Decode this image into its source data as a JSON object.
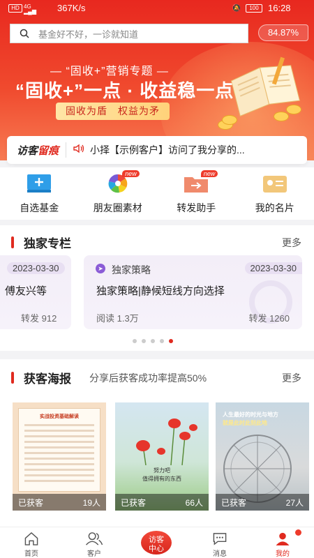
{
  "status_bar": {
    "network": "4G",
    "hd": "HD",
    "speed": "367K/s",
    "battery": "100",
    "time": "16:28"
  },
  "search": {
    "placeholder": "基金好不好，一诊就知道",
    "percent": "84.87%"
  },
  "banner": {
    "subtitle": "— “固收+”营销专题 —",
    "title": "“固收+”一点 · 收益稳一点",
    "slogan": "固收为盾　权益为矛"
  },
  "visitor_trace": {
    "tag_part1": "访客",
    "tag_part2": "留痕",
    "message": "小择【示例客户】访问了我分享的..."
  },
  "tools": [
    {
      "label": "自选基金",
      "icon": "add-fund-icon",
      "new": false
    },
    {
      "label": "朋友圈素材",
      "icon": "moments-material-icon",
      "new": true,
      "badge": "new"
    },
    {
      "label": "转发助手",
      "icon": "forward-assistant-icon",
      "new": true,
      "badge": "new"
    },
    {
      "label": "我的名片",
      "icon": "business-card-icon",
      "new": false
    }
  ],
  "exclusive": {
    "title": "独家专栏",
    "more": "更多",
    "cards": [
      {
        "date": "2023-03-30",
        "headline": "、傅友兴等",
        "read": "",
        "share": "转发 912"
      },
      {
        "category": "独家策略",
        "date": "2023-03-30",
        "headline": "独家策略|静候短线方向选择",
        "read": "阅读 1.3万",
        "share": "转发 1260"
      }
    ],
    "pager": {
      "count": 5,
      "active": 4
    }
  },
  "posters_section": {
    "title": "获客海报",
    "subtitle": "分享后获客成功率提高50%",
    "more": "更多",
    "posters": [
      {
        "header": "实战投资基础解读",
        "label": "已获客",
        "count": "19人"
      },
      {
        "caption1": "努力吧",
        "caption2": "值得拥有的东西",
        "label": "已获客",
        "count": "66人"
      },
      {
        "quote1": "人生最好的时光与地方",
        "quote2": "就是此时此刻此地",
        "label": "已获客",
        "count": "27人"
      }
    ]
  },
  "tabbar": {
    "items": [
      {
        "label": "首页",
        "icon": "home-icon"
      },
      {
        "label": "客户",
        "icon": "customers-icon"
      },
      {
        "label": "访客中心",
        "icon": "visitor-center-icon"
      },
      {
        "label": "消息",
        "icon": "message-icon"
      },
      {
        "label": "我的",
        "icon": "profile-icon"
      }
    ],
    "center_label_line1": "访客",
    "center_label_line2": "中心"
  },
  "colors": {
    "brand_red": "#e02a1f",
    "banner_gold": "#ffd27a",
    "card_lavender": "#f3eef8"
  }
}
